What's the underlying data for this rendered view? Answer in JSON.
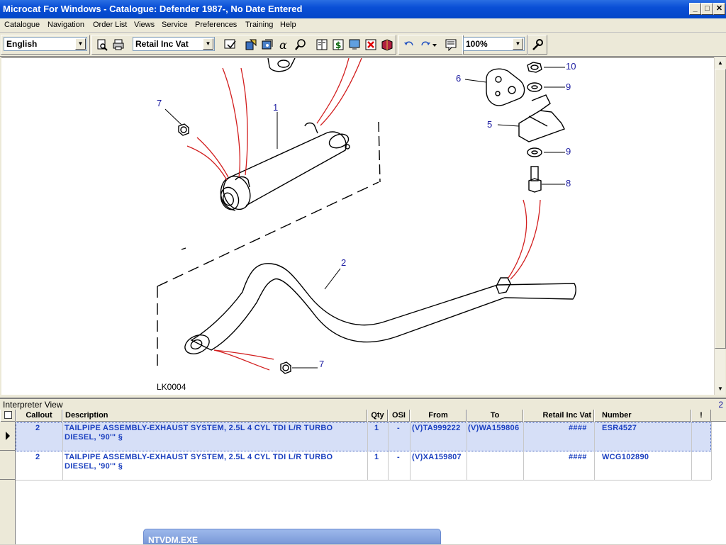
{
  "window": {
    "title": "Microcat For Windows - Catalogue: Defender 1987-, No Date Entered",
    "minimize": "_",
    "maximize": "□",
    "close": "✕"
  },
  "menu": [
    "Catalogue",
    "Navigation",
    "Order List",
    "Views",
    "Service",
    "Preferences",
    "Training",
    "Help"
  ],
  "toolbar": {
    "language": "English",
    "price_mode": "Retail Inc Vat",
    "zoom": "100%",
    "icons": [
      "print-preview-icon",
      "print-icon",
      "hand-pointer-icon",
      "bookmark-icon",
      "lookup-icon",
      "alpha-index-icon",
      "magnifier-search-icon",
      "catalogue-icon",
      "price-icon",
      "screen-icon",
      "delete-icon",
      "book-icon",
      "undo-icon",
      "redo-icon",
      "notes-icon",
      "settings-wrench-icon"
    ]
  },
  "diagram": {
    "reference": "LK0004",
    "callouts": [
      "7",
      "1",
      "6",
      "10",
      "9",
      "5",
      "9",
      "8",
      "2",
      "7"
    ]
  },
  "interpreter": {
    "title": "Interpreter View",
    "count": "2",
    "columns": [
      "Callout",
      "Description",
      "Qty",
      "OSI",
      "From",
      "To",
      "Retail Inc Vat",
      "Number",
      "!"
    ],
    "rows": [
      {
        "callout": "2",
        "desc1": "TAILPIPE ASSEMBLY-EXHAUST SYSTEM, 2.5L 4 CYL TDI L/R TURBO",
        "desc2": "DIESEL, '90'\" §",
        "qty": "1",
        "osi": "-",
        "from": "(V)TA999222",
        "to": "(V)WA159806",
        "price": "####",
        "number": "ESR4527",
        "selected": true
      },
      {
        "callout": "2",
        "desc1": "TAILPIPE ASSEMBLY-EXHAUST SYSTEM, 2.5L 4 CYL TDI L/R TURBO",
        "desc2": "DIESEL, '90'\" §",
        "qty": "1",
        "osi": "-",
        "from": "(V)XA159807",
        "to": "",
        "price": "####",
        "number": "WCG102890",
        "selected": false
      }
    ]
  },
  "popup": {
    "title": "NTVDM.EXE"
  }
}
